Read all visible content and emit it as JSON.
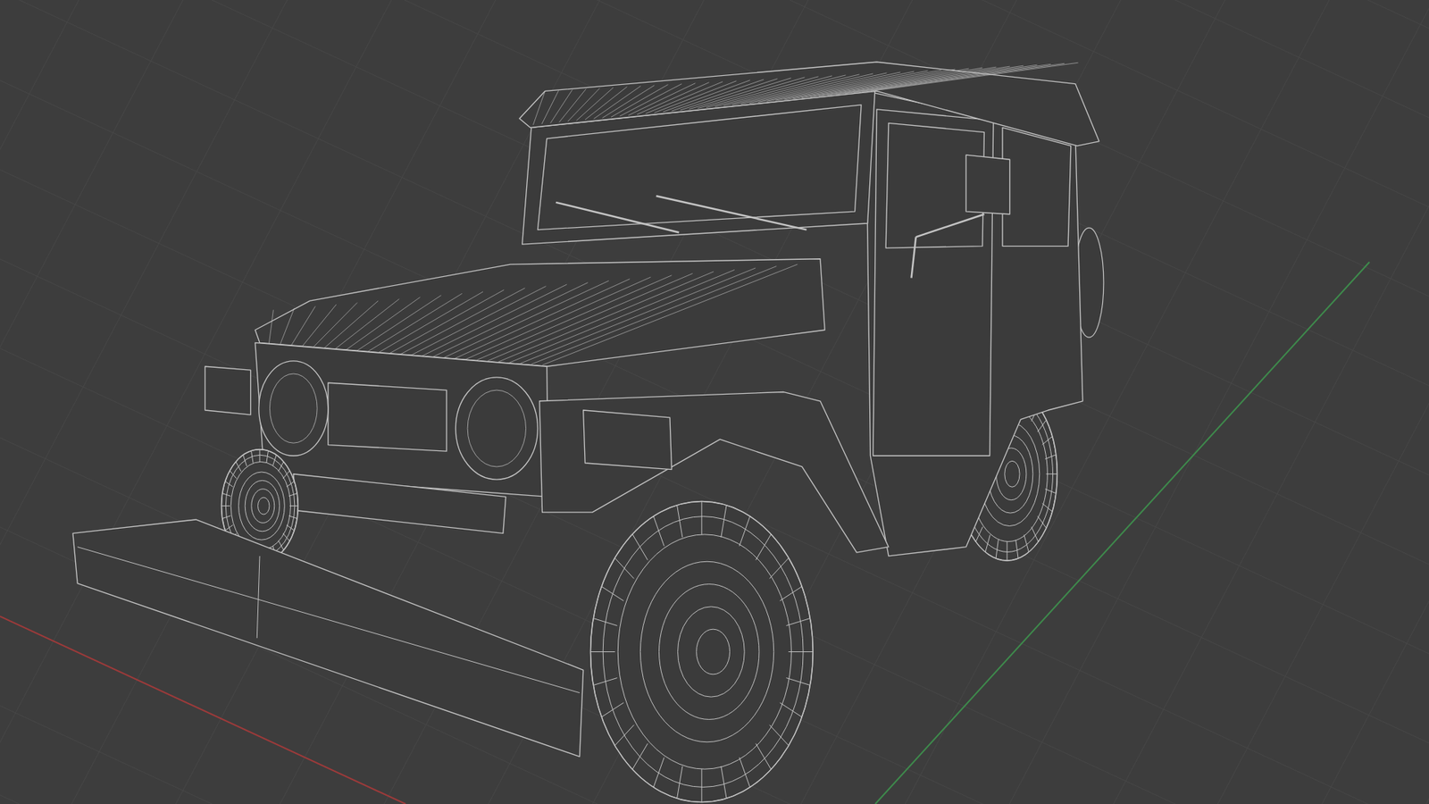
{
  "viewport": {
    "grid": true,
    "axes": [
      {
        "name": "x",
        "color": "#9c3a3a",
        "from": [
          0,
          828
        ],
        "to": [
          545,
          1080
        ]
      },
      {
        "name": "y",
        "color": "#3e8a4c",
        "from": [
          1176,
          1080
        ],
        "to": [
          1840,
          352
        ]
      }
    ]
  }
}
